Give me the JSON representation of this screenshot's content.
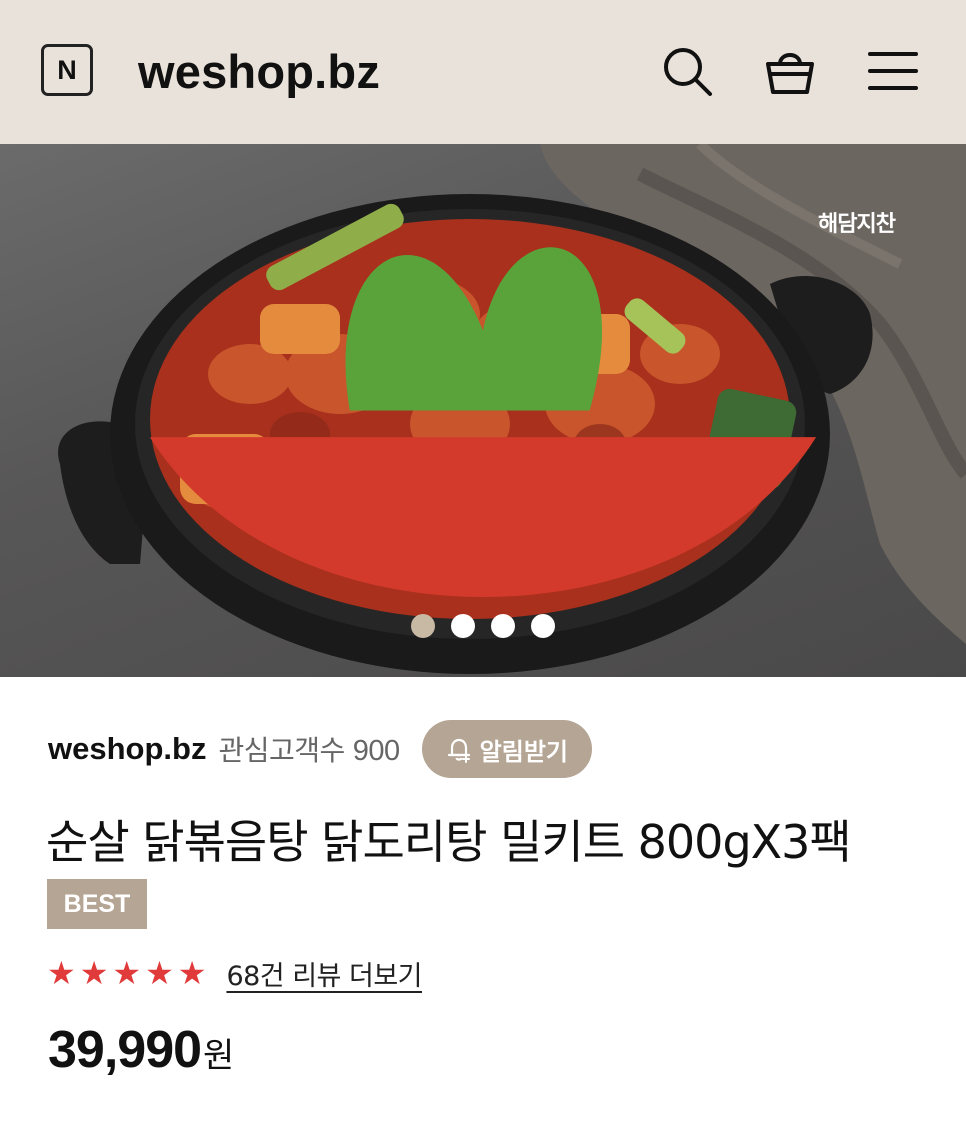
{
  "header": {
    "logo_letter": "N",
    "site_title": "weshop.bz",
    "icons": [
      "search-icon",
      "shopping-bag-icon",
      "menu-icon"
    ]
  },
  "hero": {
    "brand_logo_text": "해담지찬",
    "slides": 4,
    "active_slide": 1
  },
  "shop": {
    "name": "weshop.bz",
    "follower_label": "관심고객수",
    "follower_count": "900",
    "alarm_button": "알림받기"
  },
  "product": {
    "title": "순살 닭볶음탕 닭도리탕 밀키트 800gX3팩",
    "badge": "BEST",
    "rating_stars": 5,
    "review_link": "68건 리뷰 더보기",
    "price": "39,990",
    "price_unit": "원"
  },
  "colors": {
    "header_bg": "#e8e2da",
    "accent": "#b4a594",
    "star": "#e03a3a"
  }
}
